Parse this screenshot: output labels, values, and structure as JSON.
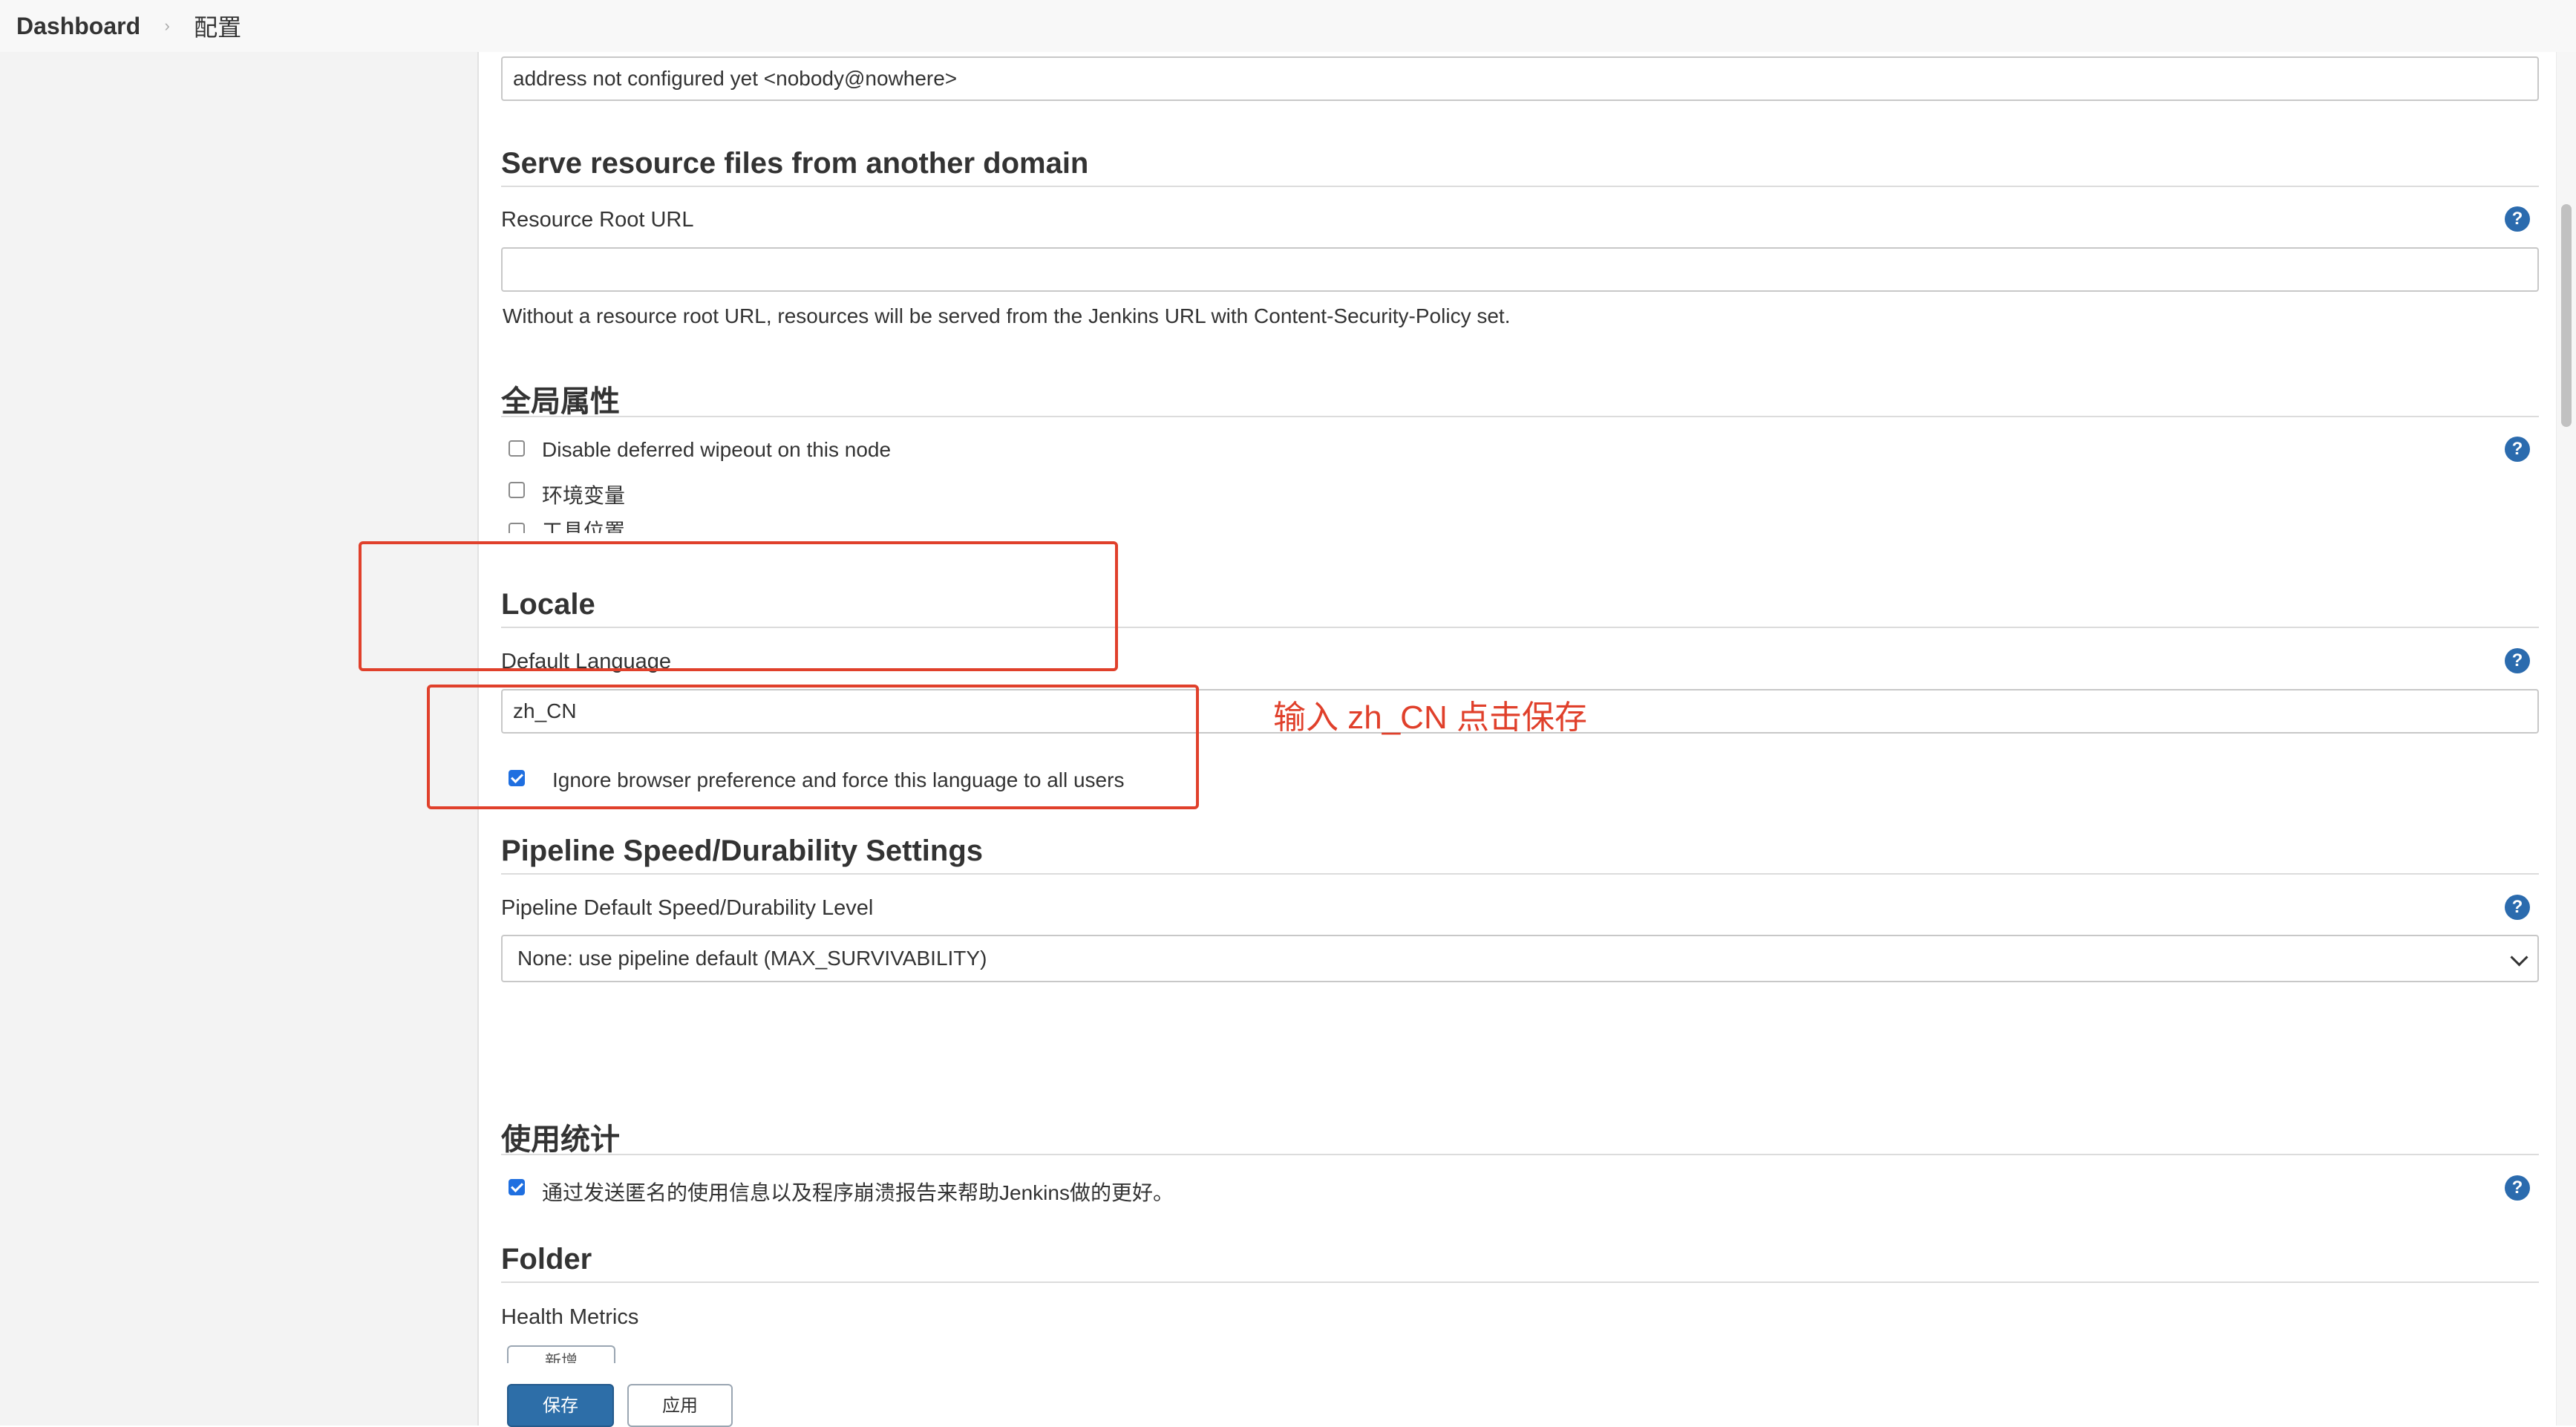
{
  "breadcrumb": {
    "dashboard": "Dashboard",
    "separator": "›",
    "current": "配置"
  },
  "admin_email": {
    "value": "address not configured yet <nobody@nowhere>"
  },
  "resource_domain": {
    "title": "Serve resource files from another domain",
    "label": "Resource Root URL",
    "value": "",
    "description": "Without a resource root URL, resources will be served from the Jenkins URL with Content-Security-Policy set."
  },
  "global_properties": {
    "title": "全局属性",
    "items": [
      {
        "label": "Disable deferred wipeout on this node",
        "checked": false
      },
      {
        "label": "环境变量",
        "checked": false
      },
      {
        "label": "工具位置",
        "checked": false
      }
    ]
  },
  "locale": {
    "title": "Locale",
    "label": "Default Language",
    "value": "zh_CN",
    "ignore_browser_label": "Ignore browser preference and force this language to all users",
    "ignore_browser_checked": true
  },
  "annotation": {
    "text": "输入 zh_CN  点击保存",
    "color": "#e0402b"
  },
  "pipeline": {
    "title": "Pipeline Speed/Durability Settings",
    "label": "Pipeline Default Speed/Durability Level",
    "selected": "None: use pipeline default (MAX_SURVIVABILITY)"
  },
  "usage": {
    "title": "使用统计",
    "label": "通过发送匿名的使用信息以及程序崩溃报告来帮助Jenkins做的更好。",
    "checked": true
  },
  "folder": {
    "title": "Folder",
    "label": "Health Metrics",
    "add_button": "新增"
  },
  "buttons": {
    "save": "保存",
    "apply": "应用"
  },
  "icons": {
    "help": "help-icon",
    "help_glyph": "?",
    "chevron": "chevron-down-icon"
  },
  "colors": {
    "primary_button": "#2d6ea8",
    "help_icon": "#2b6bae",
    "checkbox_checked": "#1f6fe0",
    "annotation": "#e0402b"
  }
}
